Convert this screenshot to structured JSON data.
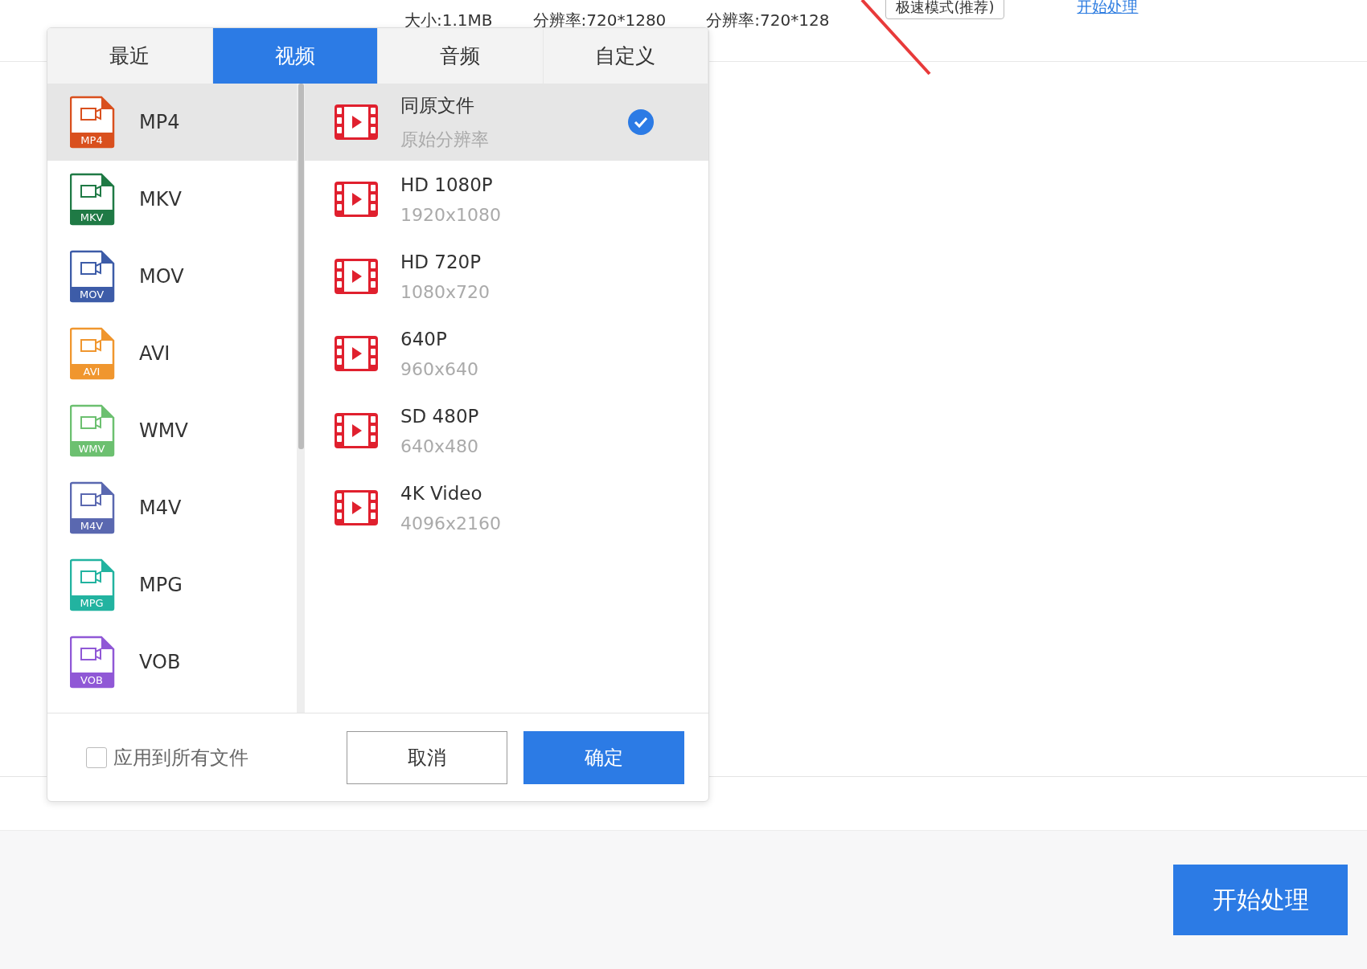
{
  "file_info": {
    "size": "大小:1.1MB",
    "resolution_source": "分辨率:720*1280",
    "resolution_output": "分辨率:720*128",
    "mode_select": "极速模式(推荐)",
    "start_link": "开始处理"
  },
  "format_dialog": {
    "tabs": [
      {
        "label": "最近",
        "selected": false
      },
      {
        "label": "视频",
        "selected": true
      },
      {
        "label": "音频",
        "selected": false
      },
      {
        "label": "自定义",
        "selected": false
      }
    ],
    "formats": [
      {
        "name": "MP4",
        "badge": "MP4",
        "color": "#d9501e",
        "selected": true
      },
      {
        "name": "MKV",
        "badge": "MKV",
        "color": "#1f7a45",
        "selected": false
      },
      {
        "name": "MOV",
        "badge": "MOV",
        "color": "#3d5ca8",
        "selected": false
      },
      {
        "name": "AVI",
        "badge": "AVI",
        "color": "#f0962e",
        "selected": false
      },
      {
        "name": "WMV",
        "badge": "WMV",
        "color": "#6cc070",
        "selected": false
      },
      {
        "name": "M4V",
        "badge": "M4V",
        "color": "#5a68b0",
        "selected": false
      },
      {
        "name": "MPG",
        "badge": "MPG",
        "color": "#22b3a0",
        "selected": false
      },
      {
        "name": "VOB",
        "badge": "VOB",
        "color": "#9058d6",
        "selected": false
      }
    ],
    "presets": [
      {
        "name": "同原文件",
        "detail": "原始分辨率",
        "selected": true
      },
      {
        "name": "HD 1080P",
        "detail": "1920x1080",
        "selected": false
      },
      {
        "name": "HD 720P",
        "detail": "1080x720",
        "selected": false
      },
      {
        "name": "640P",
        "detail": "960x640",
        "selected": false
      },
      {
        "name": "SD 480P",
        "detail": "640x480",
        "selected": false
      },
      {
        "name": "4K Video",
        "detail": "4096x2160",
        "selected": false
      }
    ],
    "apply_all": {
      "label": "应用到所有文件",
      "checked": false
    },
    "cancel": "取消",
    "confirm": "确定"
  },
  "start_button": "开始处理"
}
